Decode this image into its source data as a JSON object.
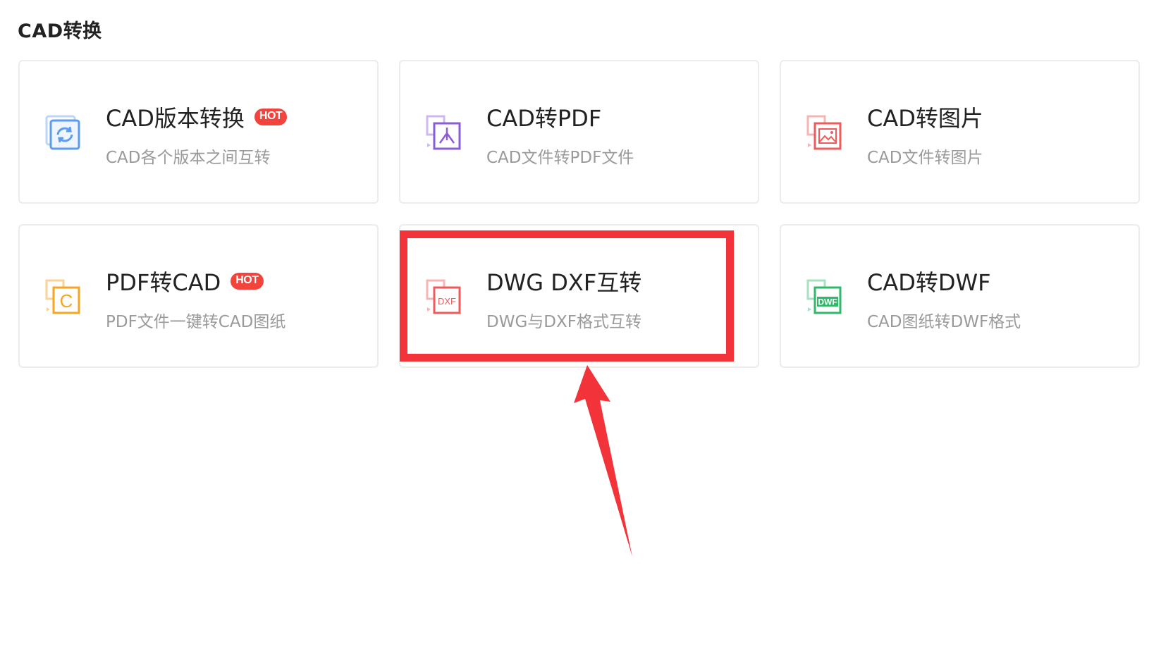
{
  "section": {
    "title": "CAD转换"
  },
  "cards": [
    {
      "title": "CAD版本转换",
      "desc": "CAD各个版本之间互转",
      "hot": "HOT",
      "icon": "refresh-doc-icon",
      "color": "#5b9cf0"
    },
    {
      "title": "CAD转PDF",
      "desc": "CAD文件转PDF文件",
      "hot": "",
      "icon": "pdf-doc-icon",
      "color": "#8a5cd6"
    },
    {
      "title": "CAD转图片",
      "desc": "CAD文件转图片",
      "hot": "",
      "icon": "image-doc-icon",
      "color": "#ef5b5b"
    },
    {
      "title": "PDF转CAD",
      "desc": "PDF文件一键转CAD图纸",
      "hot": "HOT",
      "icon": "cad-doc-icon",
      "color": "#f5a623"
    },
    {
      "title": "DWG DXF互转",
      "desc": "DWG与DXF格式互转",
      "hot": "",
      "icon": "dxf-doc-icon",
      "color": "#ef5b5b"
    },
    {
      "title": "CAD转DWF",
      "desc": "CAD图纸转DWF格式",
      "hot": "",
      "icon": "dwf-doc-icon",
      "color": "#2fba6a"
    }
  ],
  "icon_labels": {
    "cad": "C",
    "dxf": "DXF",
    "dwf": "DWF"
  },
  "annotation": {
    "color": "#f2333a"
  }
}
